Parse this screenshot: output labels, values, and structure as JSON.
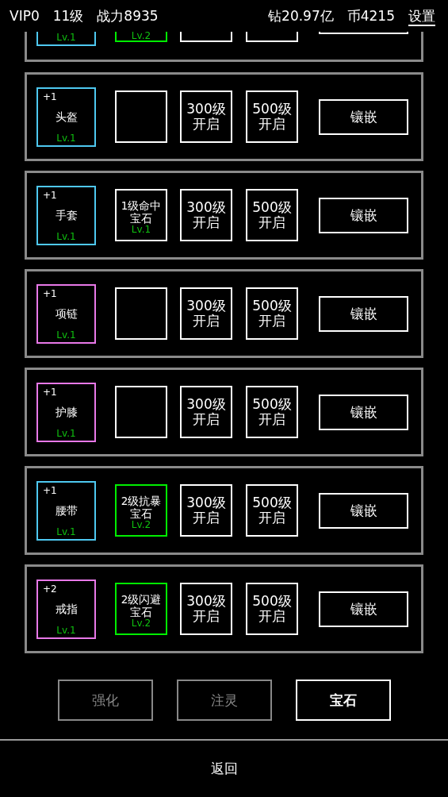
{
  "header": {
    "vip": "VIP0",
    "level": "11级",
    "power": "战力8935",
    "diamonds": "钻20.97亿",
    "coins": "币4215",
    "settings": "设置"
  },
  "clipped_row": {
    "equipment": {
      "level": "Lv.1",
      "color": "#4ec8f0"
    },
    "gem": {
      "level": "Lv.2",
      "color": "#00ee00"
    }
  },
  "rows": [
    {
      "plus": "+1",
      "name": "头盔",
      "level": "Lv.1",
      "color": "#4ec8f0",
      "gem": {
        "kind": "empty"
      },
      "locked_slots": [
        "300级开启",
        "500级开启"
      ],
      "button": "镶嵌"
    },
    {
      "plus": "+1",
      "name": "手套",
      "level": "Lv.1",
      "color": "#4ec8f0",
      "gem": {
        "kind": "gem",
        "name": "1级命中宝石",
        "level": "Lv.1",
        "color": "#ffffff"
      },
      "locked_slots": [
        "300级开启",
        "500级开启"
      ],
      "button": "镶嵌"
    },
    {
      "plus": "+1",
      "name": "项链",
      "level": "Lv.1",
      "color": "#e878e8",
      "gem": {
        "kind": "empty"
      },
      "locked_slots": [
        "300级开启",
        "500级开启"
      ],
      "button": "镶嵌"
    },
    {
      "plus": "+1",
      "name": "护膝",
      "level": "Lv.1",
      "color": "#e878e8",
      "gem": {
        "kind": "empty"
      },
      "locked_slots": [
        "300级开启",
        "500级开启"
      ],
      "button": "镶嵌"
    },
    {
      "plus": "+1",
      "name": "腰带",
      "level": "Lv.1",
      "color": "#4ec8f0",
      "gem": {
        "kind": "gem",
        "name": "2级抗暴宝石",
        "level": "Lv.2",
        "color": "#00ee00"
      },
      "locked_slots": [
        "300级开启",
        "500级开启"
      ],
      "button": "镶嵌"
    },
    {
      "plus": "+2",
      "name": "戒指",
      "level": "Lv.1",
      "color": "#e878e8",
      "gem": {
        "kind": "gem",
        "name": "2级闪避宝石",
        "level": "Lv.2",
        "color": "#00ee00"
      },
      "locked_slots": [
        "300级开启",
        "500级开启"
      ],
      "button": "镶嵌"
    }
  ],
  "tabs": [
    {
      "label": "强化",
      "selected": false
    },
    {
      "label": "注灵",
      "selected": false
    },
    {
      "label": "宝石",
      "selected": true
    }
  ],
  "back": "返回"
}
